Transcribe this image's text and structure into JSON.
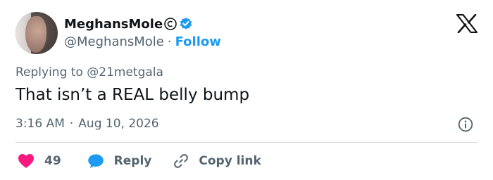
{
  "author": {
    "display_name": "MeghansMole",
    "handle": "@MeghansMole",
    "separator": "·",
    "follow_label": "Follow"
  },
  "brand": {
    "logo_icon": "x-logo-icon"
  },
  "tweet": {
    "replying_to_prefix": "Replying to ",
    "replying_to_handle": "@21metgala",
    "text": "That isn’t a REAL belly bump",
    "time": "3:16 AM",
    "date": "Aug 10, 2026",
    "meta_separator": "·"
  },
  "actions": {
    "like_count": "49",
    "reply_label": "Reply",
    "copy_link_label": "Copy link"
  },
  "colors": {
    "accent": "#1d9bf0",
    "heart": "#f91880",
    "text": "#0f1419",
    "secondary": "#536471"
  }
}
